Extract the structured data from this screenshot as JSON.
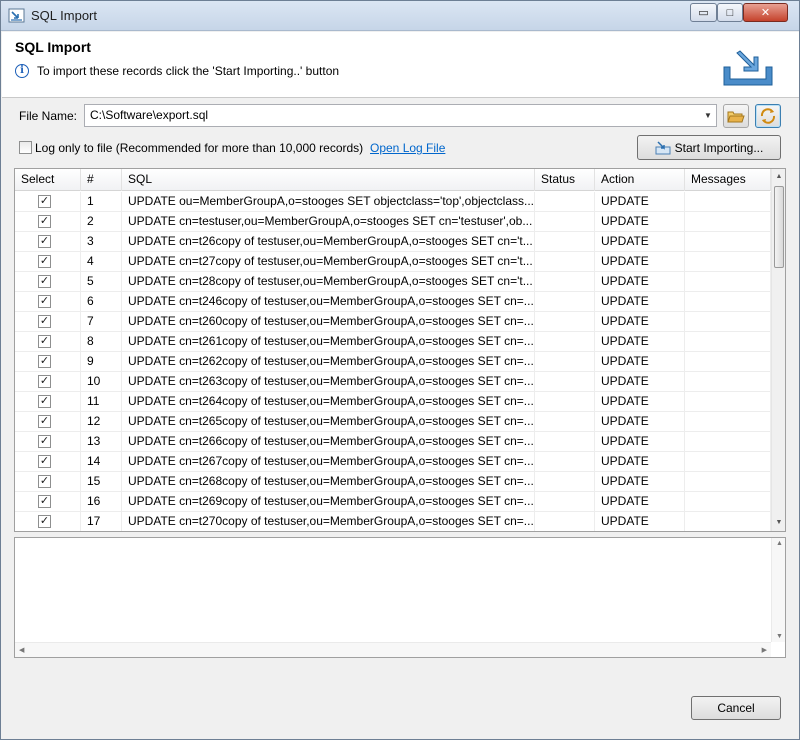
{
  "window": {
    "title": "SQL Import",
    "minimize_glyph": "▭",
    "maximize_glyph": "□",
    "close_glyph": "✕"
  },
  "header": {
    "title": "SQL Import",
    "info_icon": "info-icon",
    "info_glyph": "i",
    "message": "To import these records click the 'Start Importing..' button"
  },
  "file": {
    "label": "File Name:",
    "value": "C:\\Software\\export.sql",
    "dropdown_glyph": "▼"
  },
  "log": {
    "label": "Log only to file (Recommended for more than 10,000 records)",
    "checked": false,
    "open_log_link": "Open Log File"
  },
  "start_button": {
    "label": "Start Importing..."
  },
  "table": {
    "columns": [
      "Select",
      "#",
      "SQL",
      "Status",
      "Action",
      "Messages"
    ],
    "rows": [
      {
        "checked": true,
        "num": "1",
        "sql": "UPDATE ou=MemberGroupA,o=stooges SET objectclass='top',objectclass...",
        "status": "",
        "action": "UPDATE",
        "messages": ""
      },
      {
        "checked": true,
        "num": "2",
        "sql": "UPDATE cn=testuser,ou=MemberGroupA,o=stooges SET cn='testuser',ob...",
        "status": "",
        "action": "UPDATE",
        "messages": ""
      },
      {
        "checked": true,
        "num": "3",
        "sql": "UPDATE cn=t26copy of testuser,ou=MemberGroupA,o=stooges SET cn='t...",
        "status": "",
        "action": "UPDATE",
        "messages": ""
      },
      {
        "checked": true,
        "num": "4",
        "sql": "UPDATE cn=t27copy of testuser,ou=MemberGroupA,o=stooges SET cn='t...",
        "status": "",
        "action": "UPDATE",
        "messages": ""
      },
      {
        "checked": true,
        "num": "5",
        "sql": "UPDATE cn=t28copy of testuser,ou=MemberGroupA,o=stooges SET cn='t...",
        "status": "",
        "action": "UPDATE",
        "messages": ""
      },
      {
        "checked": true,
        "num": "6",
        "sql": "UPDATE cn=t246copy of testuser,ou=MemberGroupA,o=stooges SET cn=...",
        "status": "",
        "action": "UPDATE",
        "messages": ""
      },
      {
        "checked": true,
        "num": "7",
        "sql": "UPDATE cn=t260copy of testuser,ou=MemberGroupA,o=stooges SET cn=...",
        "status": "",
        "action": "UPDATE",
        "messages": ""
      },
      {
        "checked": true,
        "num": "8",
        "sql": "UPDATE cn=t261copy of testuser,ou=MemberGroupA,o=stooges SET cn=...",
        "status": "",
        "action": "UPDATE",
        "messages": ""
      },
      {
        "checked": true,
        "num": "9",
        "sql": "UPDATE cn=t262copy of testuser,ou=MemberGroupA,o=stooges SET cn=...",
        "status": "",
        "action": "UPDATE",
        "messages": ""
      },
      {
        "checked": true,
        "num": "10",
        "sql": "UPDATE cn=t263copy of testuser,ou=MemberGroupA,o=stooges SET cn=...",
        "status": "",
        "action": "UPDATE",
        "messages": ""
      },
      {
        "checked": true,
        "num": "11",
        "sql": "UPDATE cn=t264copy of testuser,ou=MemberGroupA,o=stooges SET cn=...",
        "status": "",
        "action": "UPDATE",
        "messages": ""
      },
      {
        "checked": true,
        "num": "12",
        "sql": "UPDATE cn=t265copy of testuser,ou=MemberGroupA,o=stooges SET cn=...",
        "status": "",
        "action": "UPDATE",
        "messages": ""
      },
      {
        "checked": true,
        "num": "13",
        "sql": "UPDATE cn=t266copy of testuser,ou=MemberGroupA,o=stooges SET cn=...",
        "status": "",
        "action": "UPDATE",
        "messages": ""
      },
      {
        "checked": true,
        "num": "14",
        "sql": "UPDATE cn=t267copy of testuser,ou=MemberGroupA,o=stooges SET cn=...",
        "status": "",
        "action": "UPDATE",
        "messages": ""
      },
      {
        "checked": true,
        "num": "15",
        "sql": "UPDATE cn=t268copy of testuser,ou=MemberGroupA,o=stooges SET cn=...",
        "status": "",
        "action": "UPDATE",
        "messages": ""
      },
      {
        "checked": true,
        "num": "16",
        "sql": "UPDATE cn=t269copy of testuser,ou=MemberGroupA,o=stooges SET cn=...",
        "status": "",
        "action": "UPDATE",
        "messages": ""
      },
      {
        "checked": true,
        "num": "17",
        "sql": "UPDATE cn=t270copy of testuser,ou=MemberGroupA,o=stooges SET cn=...",
        "status": "",
        "action": "UPDATE",
        "messages": ""
      }
    ],
    "check_glyph": "✓"
  },
  "log_output": {
    "text": ""
  },
  "cancel_button": {
    "label": "Cancel"
  },
  "colors": {
    "link": "#0066cc",
    "info": "#1c5fb8",
    "accent_blue": "#2a6fb0",
    "folder": "#e8b24a"
  }
}
